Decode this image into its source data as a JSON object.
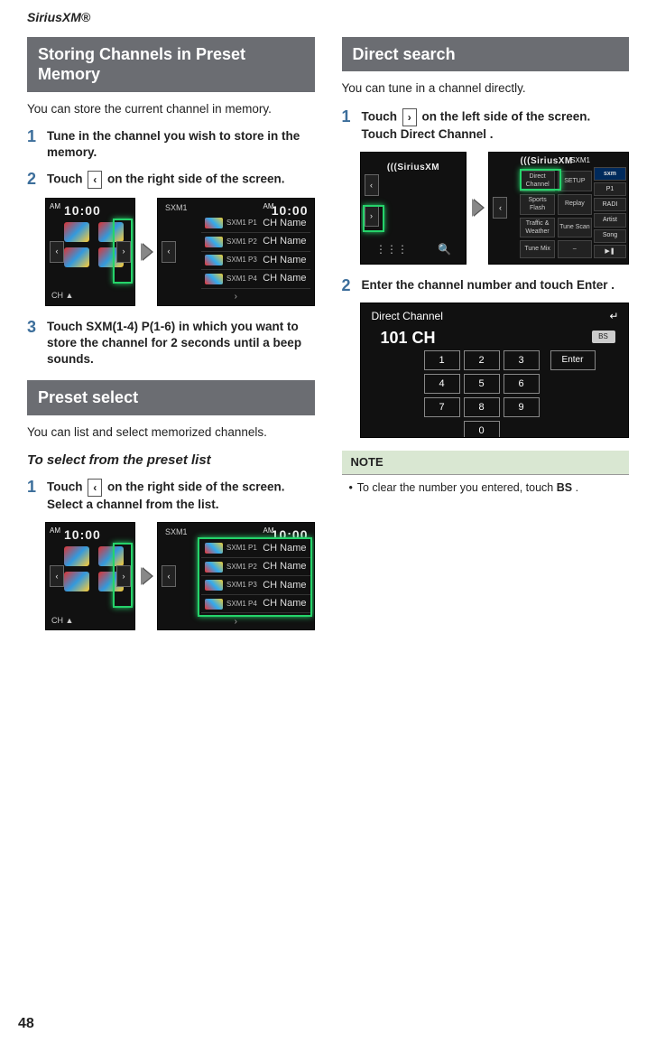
{
  "page_header": "SiriusXM®",
  "page_number": "48",
  "left": {
    "section1": {
      "title": "Storing Channels in Preset Memory",
      "intro": "You can store the current channel in memory.",
      "step1": "Tune in the channel you wish to store in the memory.",
      "step2_a": "Touch ",
      "step2_key": "‹",
      "step2_b": " on the right side of the screen.",
      "step3_a": "Touch ",
      "step3_kw": "SXM(1-4) P(1-6)",
      "step3_b": " in which you want to store the channel for 2 seconds until a beep sounds.",
      "step_nums": {
        "n1": "1",
        "n2": "2",
        "n3": "3"
      },
      "fig": {
        "clock": "10:00",
        "band_label": "SXM1",
        "preset_labels": [
          "SXM1 P1",
          "SXM1 P2",
          "SXM1 P3",
          "SXM1 P4"
        ],
        "ch_name": "CH Name",
        "ch_up": "CH ▲",
        "am_label": "AM",
        "expand": "›"
      }
    },
    "section2": {
      "title": "Preset select",
      "intro": "You can list and select memorized channels.",
      "sub": "To select from the preset list",
      "step1_a": "Touch ",
      "step1_key": "‹",
      "step1_b": " on the right side of the screen. Select a channel from the list.",
      "step_nums": {
        "n1": "1"
      }
    }
  },
  "right": {
    "section1": {
      "title": "Direct search",
      "intro": "You can tune in a channel directly.",
      "step1_a": "Touch ",
      "step1_key": "›",
      "step1_b": " on the left side of the screen. Touch ",
      "step1_kw": "Direct Channel",
      "step1_c": " .",
      "step2_a": "Enter the channel number and touch ",
      "step2_kw": "Enter",
      "step2_b": " .",
      "step_nums": {
        "n1": "1",
        "n2": "2"
      },
      "fig_ds": {
        "logo": "SiriusXM",
        "band": "SXM1",
        "buttons": [
          "Direct Channel",
          "SETUP",
          "Sports Flash",
          "Replay",
          "Traffic & Weather",
          "Tune Scan",
          "Tune Mix",
          "–"
        ],
        "right_labels": [
          "P1",
          "RADI",
          "Artist",
          "Song",
          "▶❚"
        ],
        "sxm_logo": "sxm",
        "search_icon": "🔍",
        "grid_icon": "⋮⋮⋮"
      },
      "keypad": {
        "title": "Direct Channel",
        "display": "101 CH",
        "bs": "BS",
        "keys": [
          "1",
          "2",
          "3",
          "4",
          "5",
          "6",
          "7",
          "8",
          "9"
        ],
        "zero": "0",
        "enter": "Enter",
        "back_icon": "↵"
      }
    },
    "note": {
      "head": "NOTE",
      "body_a": "To clear the number you entered, touch ",
      "body_kw": "BS",
      "body_b": " ."
    }
  }
}
